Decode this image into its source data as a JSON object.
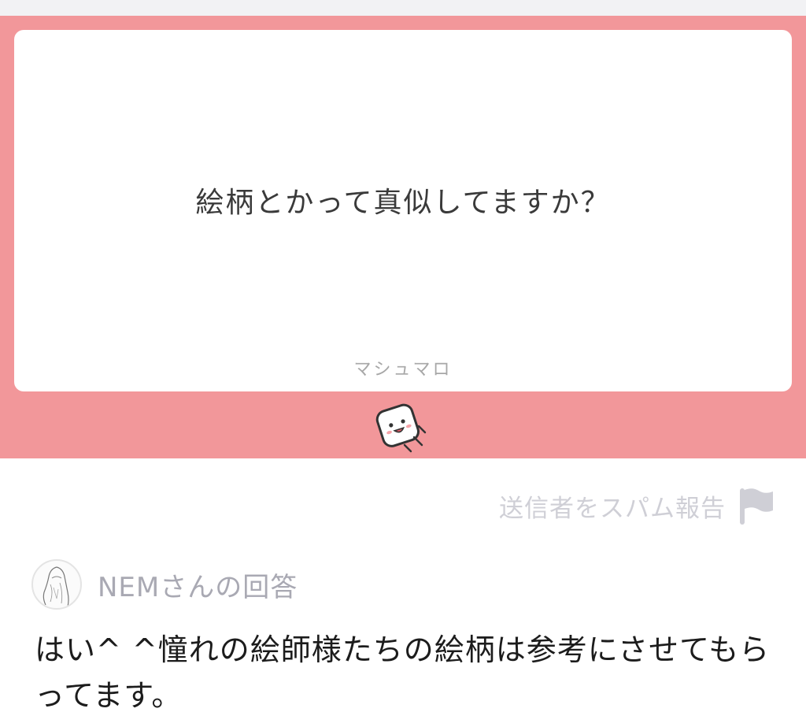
{
  "question": {
    "text": "絵柄とかって真似してますか？",
    "brand": "マシュマロ"
  },
  "mascot": {
    "icon": "marshmallow-mascot-icon"
  },
  "report": {
    "label": "送信者をスパム報告",
    "icon": "flag-icon"
  },
  "answer": {
    "answerer_label": "NEMさんの回答",
    "avatar_icon": "avatar-sketch-icon",
    "text": "はい^ ^憧れの絵師様たちの絵柄は参考にさせてもらってます。"
  },
  "colors": {
    "band": "#f2979a",
    "card": "#ffffff",
    "muted_text": "#a9a9b3",
    "report_text": "#cfcfd6"
  }
}
